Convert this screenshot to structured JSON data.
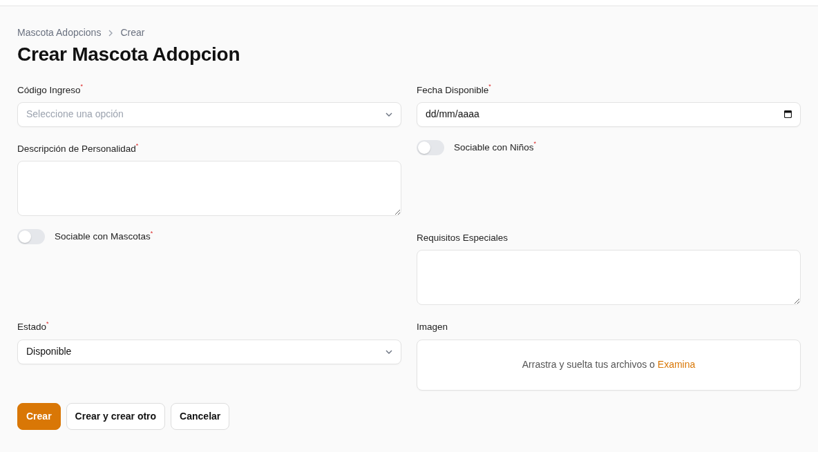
{
  "breadcrumbs": [
    {
      "label": "Mascota Adopcions"
    },
    {
      "label": "Crear"
    }
  ],
  "title": "Crear Mascota Adopcion",
  "fields": [
    {
      "kind": "select",
      "label": "Código Ingreso$^{*}$",
      "placeholder": "Seleccione una opción"
    },
    {
      "kind": "date",
      "label": "Fecha Disponible$^{*}$",
      "placeholder": "dd/mm/aaaa"
    },
    {
      "kind": "textarea",
      "label": "Descripción de Personalidad$^{*}$"
    },
    {
      "kind": "toggle",
      "label": "Sociable con Niños$^{*}$",
      "on": false
    },
    {
      "kind": "toggle",
      "label": "Sociable con Mascotas$^{*}$",
      "on": false
    },
    {
      "kind": "textarea",
      "label": "Requisitos Especiales"
    },
    {
      "kind": "select",
      "label": "Estado$^{*}$",
      "value": "Disponible"
    },
    {
      "kind": "file",
      "label": "Imagen",
      "text": "Arrastra y suelta tus archivos o",
      "link": "Examina"
    }
  ],
  "buttons": [
    {
      "label": "Crear",
      "kind": "primary"
    },
    {
      "label": "Crear y crear otro",
      "kind": "secondary"
    },
    {
      "label": "Cancelar",
      "kind": "secondary"
    }
  ]
}
